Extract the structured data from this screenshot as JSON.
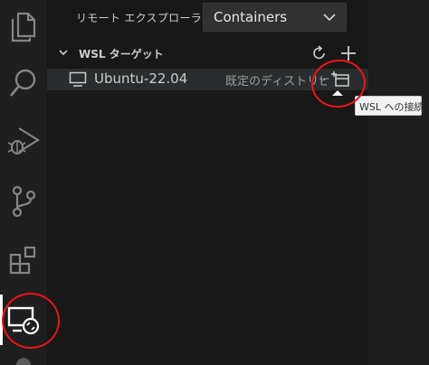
{
  "activity_bar": {
    "items": [
      {
        "icon": "files-icon"
      },
      {
        "icon": "search-icon"
      },
      {
        "icon": "run-debug-icon"
      },
      {
        "icon": "source-control-icon"
      },
      {
        "icon": "extensions-icon"
      },
      {
        "icon": "remote-explorer-icon",
        "active": true
      }
    ]
  },
  "sidebar": {
    "title": "リモート エクスプローラー",
    "dropdown": {
      "selected": "Containers"
    },
    "section": {
      "title": "WSL ターゲット",
      "actions": [
        "refresh-icon",
        "add-icon"
      ]
    },
    "rows": [
      {
        "icon": "monitor-icon",
        "label": "Ubuntu-22.04",
        "description": "既定のディストリビュ",
        "ellipsis": "...",
        "action_icon": "connect-in-window-icon"
      }
    ]
  },
  "tooltip": {
    "text": "WSL への接続"
  },
  "colors": {
    "annotation": "#e8161c",
    "background": "#181818",
    "activity_bar": "#1f1f1f",
    "dropdown_bg": "#313131",
    "row_hover": "#2a2d2e"
  }
}
